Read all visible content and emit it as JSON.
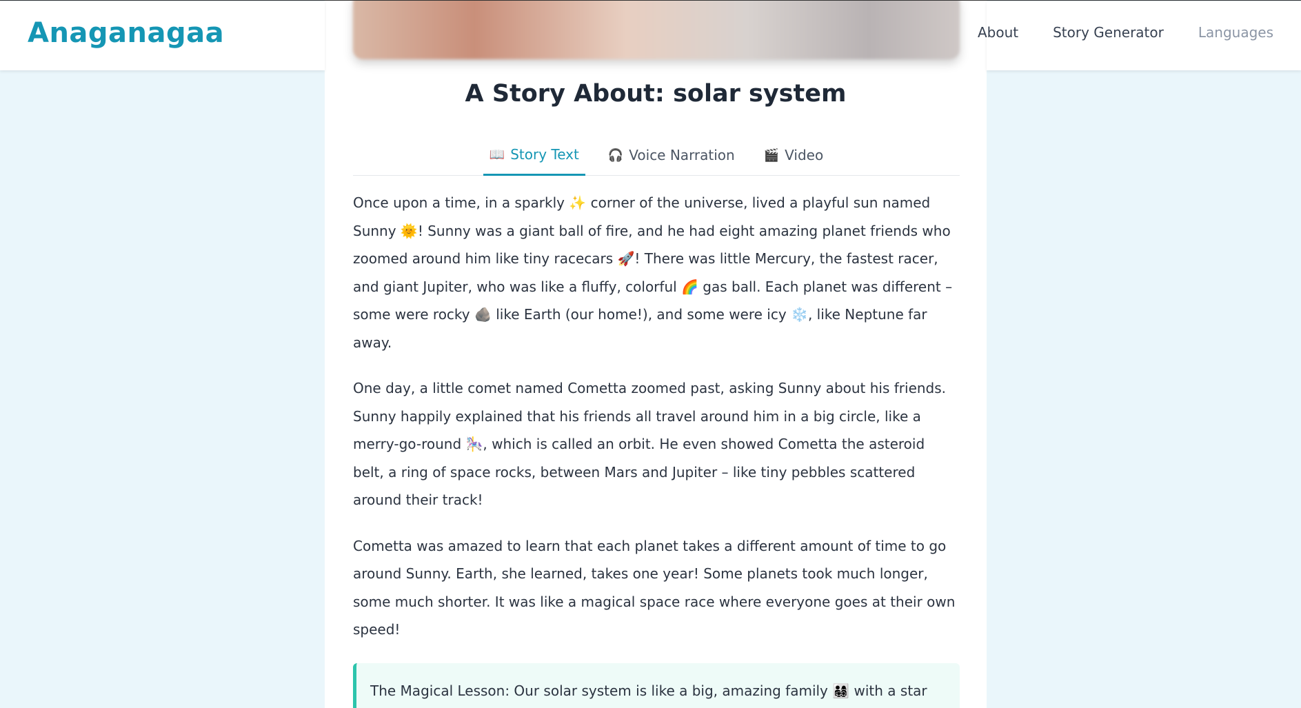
{
  "brand": "Anaganagaa",
  "nav": {
    "about": "About",
    "story_generator": "Story Generator",
    "languages": "Languages"
  },
  "story": {
    "title": "A Story About: solar system",
    "tabs": [
      {
        "icon": "📖",
        "label": "Story Text",
        "active": true
      },
      {
        "icon": "🎧",
        "label": "Voice Narration",
        "active": false
      },
      {
        "icon": "🎬",
        "label": "Video",
        "active": false
      }
    ],
    "paragraphs": [
      "Once upon a time, in a sparkly ✨ corner of the universe, lived a playful sun named Sunny 🌞! Sunny was a giant ball of fire, and he had eight amazing planet friends who zoomed around him like tiny racecars 🚀! There was little Mercury, the fastest racer, and giant Jupiter, who was like a fluffy, colorful 🌈 gas ball. Each planet was different – some were rocky 🪨 like Earth (our home!), and some were icy ❄️, like Neptune far away.",
      "One day, a little comet named Cometta zoomed past, asking Sunny about his friends. Sunny happily explained that his friends all travel around him in a big circle, like a merry-go-round 🎠, which is called an orbit. He even showed Cometta the asteroid belt, a ring of space rocks, between Mars and Jupiter – like tiny pebbles scattered around their track!",
      "Cometta was amazed to learn that each planet takes a different amount of time to go around Sunny. Earth, she learned, takes one year! Some planets took much longer, some much shorter. It was like a magical space race where everyone goes at their own speed!"
    ],
    "lesson": "The Magical Lesson: Our solar system is like a big, amazing family 👨‍👩‍👧‍👦 with a star"
  },
  "colors": {
    "accent": "#1596b4",
    "lesson_border": "#2cc4ac",
    "page_bg": "#eaf6fb"
  }
}
